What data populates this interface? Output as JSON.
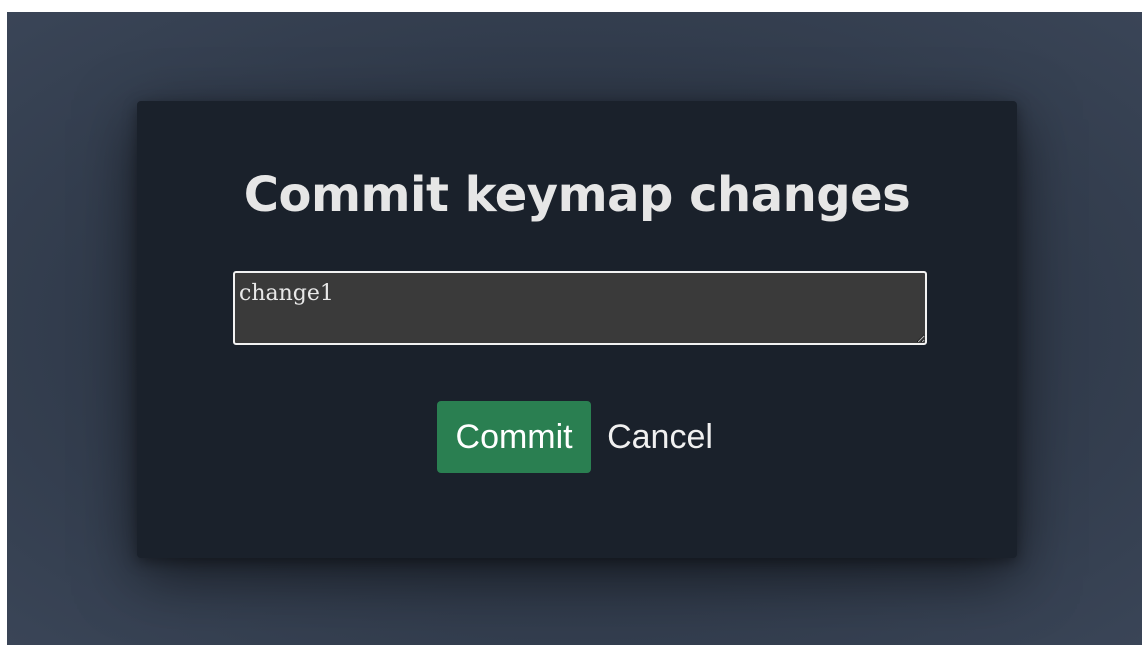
{
  "dialog": {
    "title": "Commit keymap changes",
    "message_value": "change1",
    "commit_label": "Commit",
    "cancel_label": "Cancel"
  },
  "colors": {
    "backdrop": "#303a4a",
    "dialog_bg": "#1a212b",
    "input_bg": "#3a3a3a",
    "commit_bg": "#2a7f51"
  }
}
